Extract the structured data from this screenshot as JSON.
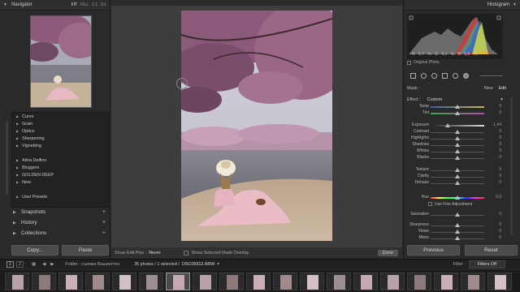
{
  "left": {
    "navigator_title": "Navigator",
    "zoom": [
      "FIT",
      "FILL",
      "1:1",
      "3:1"
    ],
    "presets": [
      {
        "label": "Curve"
      },
      {
        "label": "Grain"
      },
      {
        "label": "Optics"
      },
      {
        "label": "Sharpening"
      },
      {
        "label": "Vignetting"
      },
      {
        "label": ""
      },
      {
        "label": "Alina Delfino"
      },
      {
        "label": "Bloggers"
      },
      {
        "label": "GOLDEN DEEP"
      },
      {
        "label": "New"
      },
      {
        "label": ""
      },
      {
        "label": "User Presets"
      }
    ],
    "sections": [
      "Snapshots",
      "History",
      "Collections"
    ],
    "copy_label": "Copy...",
    "paste_label": "Paste"
  },
  "toolbar": {
    "show_pins_label": "Show Edit Pins :",
    "show_pins_value": "Never",
    "overlay_label": "Show Selected Mask Overlay",
    "done_label": "Done"
  },
  "right": {
    "histogram_title": "Histogram",
    "rgb_readout": "R 6,7 % G 6,1 % B 5,8 %",
    "original_photo_label": "Original Photo",
    "mask_label": "Mask :",
    "mask_new": "New",
    "mask_edit": "Edit",
    "effect_label": "Effect :",
    "effect_value": "Custom",
    "sliders": [
      {
        "label": "Temp",
        "value": "0",
        "pos": 0.5,
        "grad": "temp"
      },
      {
        "label": "Tint",
        "value": "0",
        "pos": 0.5,
        "grad": "tint"
      },
      {
        "label": "Exposure",
        "value": "- 1,44",
        "pos": 0.32,
        "grad": "gray"
      },
      {
        "label": "Contrast",
        "value": "0",
        "pos": 0.5,
        "grad": "none"
      },
      {
        "label": "Highlights",
        "value": "0",
        "pos": 0.5,
        "grad": "none"
      },
      {
        "label": "Shadows",
        "value": "0",
        "pos": 0.5,
        "grad": "none"
      },
      {
        "label": "Whites",
        "value": "0",
        "pos": 0.5,
        "grad": "none"
      },
      {
        "label": "Blacks",
        "value": "0",
        "pos": 0.5,
        "grad": "none"
      },
      {
        "label": "Texture",
        "value": "0",
        "pos": 0.5,
        "grad": "none"
      },
      {
        "label": "Clarity",
        "value": "0",
        "pos": 0.5,
        "grad": "none"
      },
      {
        "label": "Dehaze",
        "value": "0",
        "pos": 0.5,
        "grad": "none"
      },
      {
        "label": "Hue",
        "value": "0,0",
        "pos": 0.5,
        "grad": "hue"
      },
      {
        "label": "Saturation",
        "value": "0",
        "pos": 0.5,
        "grad": "none"
      },
      {
        "label": "Sharpness",
        "value": "0",
        "pos": 0.5,
        "grad": "none"
      },
      {
        "label": "Noise",
        "value": "0",
        "pos": 0.5,
        "grad": "none"
      },
      {
        "label": "Moire",
        "value": "0",
        "pos": 0.5,
        "grad": "none"
      }
    ],
    "fine_adjust_label": "Use Fine Adjustment",
    "previous_label": "Previous",
    "reset_label": "Reset"
  },
  "filmstrip": {
    "page1": "1",
    "page2": "2",
    "folder_label": "Folder : съемка Вашингтон",
    "count_label": "35 photos / 1 selected /",
    "selected_file": "DSC05912.ARW",
    "filter_label": "Filter :",
    "filter_value": "Filters Off",
    "thumb_count": 19
  },
  "colors": {
    "panel": "#2a2a2a",
    "canvas": "#3d3d3d",
    "accent_blossom": "#8a5d7c",
    "dress_pink": "#e7b9c2"
  }
}
